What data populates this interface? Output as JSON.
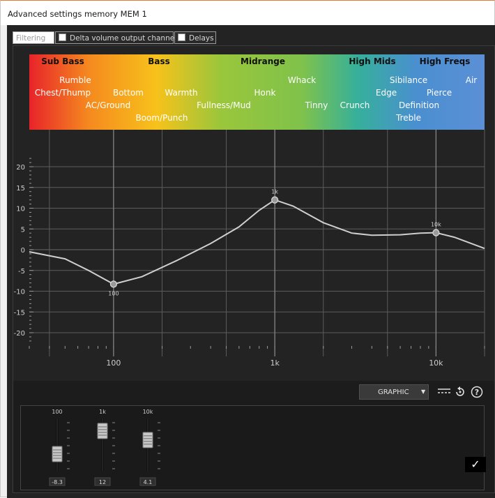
{
  "window": {
    "title": "Advanced settings memory MEM 1"
  },
  "tabs": [
    {
      "label": "Filtering",
      "active": true
    },
    {
      "label": "Delta volume output channels",
      "checkbox": true,
      "checked": false
    },
    {
      "label": "Delays",
      "checkbox": true,
      "checked": false
    }
  ],
  "colors": {
    "band_gradient": [
      "#e8232a",
      "#f5891f",
      "#f7c21b",
      "#9ac63b",
      "#7fc24b",
      "#36b09a",
      "#4a8fd0",
      "#5b8fd6"
    ],
    "curve": "#cfcfcf",
    "grid": "#5c5c5c",
    "plot_bg": "#232323"
  },
  "bands": {
    "headings": [
      "Sub Bass",
      "Bass",
      "Midrange",
      "High Mids",
      "High Freqs"
    ],
    "terms": [
      "Rumble",
      "Chest/Thump",
      "Bottom",
      "Warmth",
      "AC/Ground",
      "Boom/Punch",
      "Fullness/Mud",
      "Honk",
      "Whack",
      "Tinny",
      "Crunch",
      "Sibilance",
      "Edge",
      "Pierce",
      "Definition",
      "Treble",
      "Air"
    ]
  },
  "chart_data": {
    "type": "line",
    "x_scale": "log",
    "xlim": [
      30,
      20000
    ],
    "ylim": [
      -23,
      23
    ],
    "y_ticks": [
      20,
      15,
      10,
      5,
      0,
      -5,
      -10,
      -15,
      -20
    ],
    "x_tick_labels": [
      "100",
      "1k",
      "10k"
    ],
    "grid": true,
    "curve": {
      "x": [
        30,
        50,
        70,
        100,
        150,
        250,
        400,
        600,
        800,
        1000,
        1300,
        2000,
        3000,
        4000,
        6000,
        8000,
        10000,
        13000,
        20000
      ],
      "y": [
        -0.5,
        -2.2,
        -5,
        -8.3,
        -6.5,
        -2.5,
        1.5,
        5.5,
        9.5,
        12,
        10.5,
        6.5,
        4,
        3.5,
        3.6,
        4,
        4.1,
        3,
        0.3
      ]
    },
    "points": [
      {
        "label": "100",
        "x": 100,
        "y": -8.3
      },
      {
        "label": "1k",
        "x": 1000,
        "y": 12
      },
      {
        "label": "10k",
        "x": 10000,
        "y": 4.1
      }
    ]
  },
  "toolbar": {
    "mode": "GRAPHIC"
  },
  "faders": [
    {
      "label": "100",
      "value": -8.3,
      "value_text": "-8.3"
    },
    {
      "label": "1k",
      "value": 12,
      "value_text": "12"
    },
    {
      "label": "10k",
      "value": 4.1,
      "value_text": "4.1"
    }
  ]
}
